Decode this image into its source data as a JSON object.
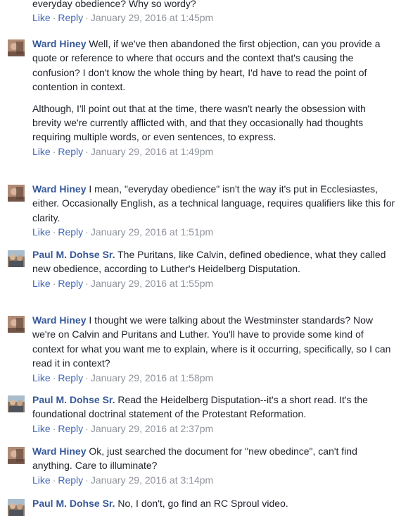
{
  "top_fragment": {
    "text": "everyday obedience? Why so wordy?",
    "like": "Like",
    "reply": "Reply",
    "time": "January 29, 2016 at 1:45pm"
  },
  "comments": [
    {
      "author": "Ward Hiney",
      "paragraphs": [
        "Well, if we've then abandoned the first objection, can you provide a quote or reference to where that occurs and the context that's causing the confusion? I don't know the whole thing by heart, I'd have to read the point of contention in context.",
        "Although, I'll point out that at the time, there wasn't nearly the obsession with brevity we're currently afflicted with, and that they occasionally had thoughts requiring multiple words, or even sentences, to express."
      ],
      "like": "Like",
      "reply": "Reply",
      "time": "January 29, 2016 at 1:49pm"
    },
    {
      "author": "Ward Hiney",
      "paragraphs": [
        "I mean, \"everyday obedience\" isn't the way it's put in Ecclesiastes, either. Occasionally English, as a technical language, requires qualifiers like this for clarity."
      ],
      "like": "Like",
      "reply": "Reply",
      "time": "January 29, 2016 at 1:51pm"
    },
    {
      "author": "Paul M. Dohse Sr.",
      "paragraphs": [
        "The Puritans, like Calvin, defined obedience, what they called new obedience, according to Luther's Heidelberg Disputation."
      ],
      "like": "Like",
      "reply": "Reply",
      "time": "January 29, 2016 at 1:55pm"
    },
    {
      "author": "Ward Hiney",
      "paragraphs": [
        "I thought we were talking about the Westminster standards? Now we're on Calvin and Puritans and Luther. You'll have to provide some kind of context for what you want me to explain, where is it occurring, specifically, so I can read it in context?"
      ],
      "like": "Like",
      "reply": "Reply",
      "time": "January 29, 2016 at 1:58pm"
    },
    {
      "author": "Paul M. Dohse Sr.",
      "paragraphs": [
        "Read the Heidelberg Disputation--it's a short read. It's the foundational doctrinal statement of the Protestant Reformation."
      ],
      "like": "Like",
      "reply": "Reply",
      "time": "January 29, 2016 at 2:37pm"
    },
    {
      "author": "Ward Hiney",
      "paragraphs": [
        "Ok, just searched the document for \"new obedince\", can't find anything. Care to illuminate?"
      ],
      "like": "Like",
      "reply": "Reply",
      "time": "January 29, 2016 at 3:14pm"
    },
    {
      "author": "Paul M. Dohse Sr.",
      "paragraphs": [
        "No, I don't, go find an RC Sproul video."
      ]
    }
  ],
  "colors": {
    "link": "#4267b2",
    "author": "#365899",
    "meta": "#90949c",
    "text": "#1d2129"
  }
}
